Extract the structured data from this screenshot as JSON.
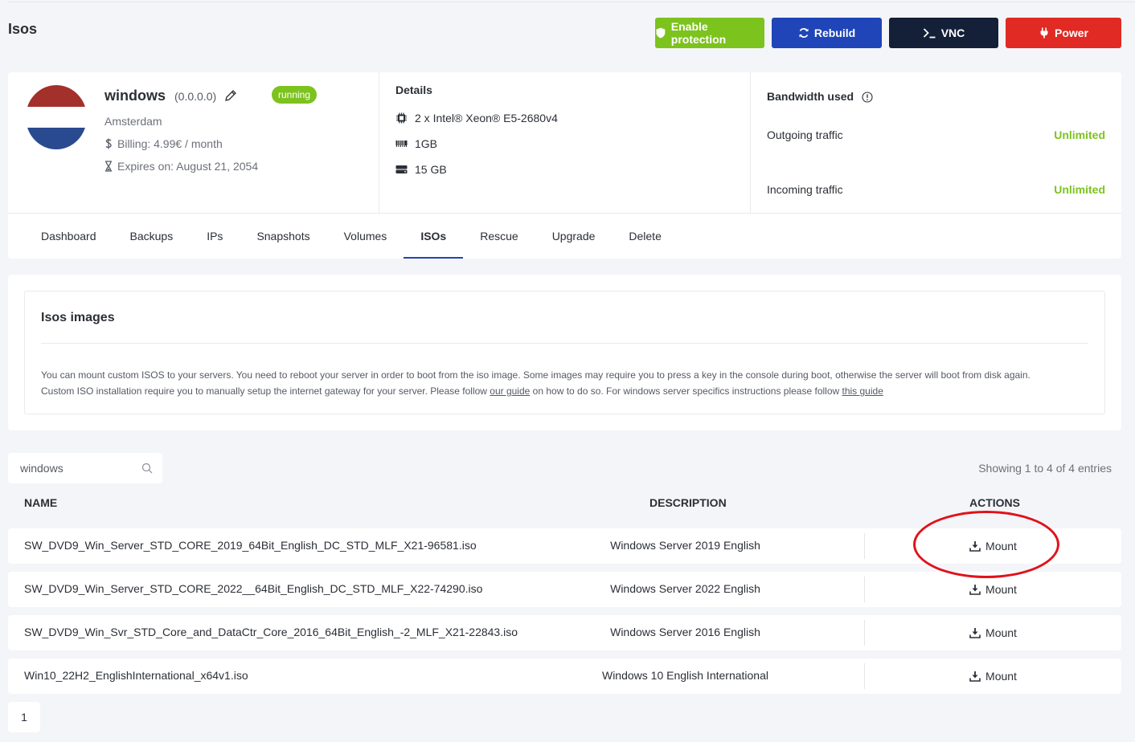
{
  "page": {
    "title": "Isos"
  },
  "header_actions": {
    "enable_protection": "Enable protection",
    "rebuild": "Rebuild",
    "vnc": "VNC",
    "power": "Power"
  },
  "server": {
    "name": "windows",
    "ip": "(0.0.0.0)",
    "status": "running",
    "location": "Amsterdam",
    "billing": "Billing: 4.99€ / month",
    "expires": "Expires on: August 21, 2054",
    "flag_colors": [
      "#a3302b",
      "#ffffff",
      "#2a4a8f"
    ]
  },
  "details": {
    "title": "Details",
    "cpu": "2 x Intel® Xeon® E5-2680v4",
    "ram": "1GB",
    "disk": "15 GB"
  },
  "bandwidth": {
    "title": "Bandwidth used",
    "outgoing_label": "Outgoing traffic",
    "outgoing_value": "Unlimited",
    "incoming_label": "Incoming traffic",
    "incoming_value": "Unlimited"
  },
  "tabs": [
    "Dashboard",
    "Backups",
    "IPs",
    "Snapshots",
    "Volumes",
    "ISOs",
    "Rescue",
    "Upgrade",
    "Delete"
  ],
  "active_tab": "ISOs",
  "iso_info": {
    "title": "Isos images",
    "line1": "You can mount custom ISOS to your servers. You need to reboot your server in order to boot from the iso image. Some images may require you to press a key in the console during boot, otherwise the server will boot from disk again.",
    "line2_a": "Custom ISO installation require you to manually setup the internet gateway for your server. Please follow ",
    "link1": "our guide",
    "line2_b": " on how to do so. For windows server specifics instructions please follow ",
    "link2": "this guide"
  },
  "search": {
    "value": "windows"
  },
  "entries_info": "Showing 1 to 4 of 4 entries",
  "table": {
    "headers": {
      "name": "NAME",
      "description": "DESCRIPTION",
      "actions": "ACTIONS"
    },
    "rows": [
      {
        "name": "SW_DVD9_Win_Server_STD_CORE_2019_64Bit_English_DC_STD_MLF_X21-96581.iso",
        "description": "Windows Server 2019 English",
        "action": "Mount"
      },
      {
        "name": "SW_DVD9_Win_Server_STD_CORE_2022__64Bit_English_DC_STD_MLF_X22-74290.iso",
        "description": "Windows Server 2022 English",
        "action": "Mount"
      },
      {
        "name": "SW_DVD9_Win_Svr_STD_Core_and_DataCtr_Core_2016_64Bit_English_-2_MLF_X21-22843.iso",
        "description": "Windows Server 2016 English",
        "action": "Mount"
      },
      {
        "name": "Win10_22H2_EnglishInternational_x64v1.iso",
        "description": "Windows 10 English International",
        "action": "Mount"
      }
    ]
  },
  "pagination": {
    "current": "1"
  },
  "colors": {
    "accent_green": "#7cc31e",
    "accent_blue": "#1f45b8",
    "dark": "#142038",
    "danger": "#e02a23",
    "highlight": "#e0121a"
  }
}
